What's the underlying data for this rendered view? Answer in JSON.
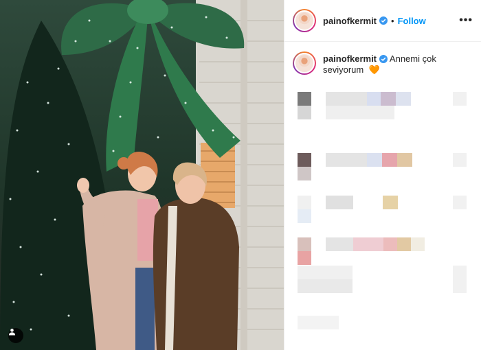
{
  "post": {
    "username": "painofkermit",
    "follow_label": "Follow",
    "more_label": "•••",
    "caption_text": "Annemi çok seviyorum",
    "caption_emoji": "🧡"
  },
  "colors": {
    "follow": "#0095f6",
    "verified": "#3897f0",
    "heart": "#e8762c"
  },
  "icons": [
    "verified-badge-icon",
    "more-options-icon",
    "user-tag-icon"
  ]
}
